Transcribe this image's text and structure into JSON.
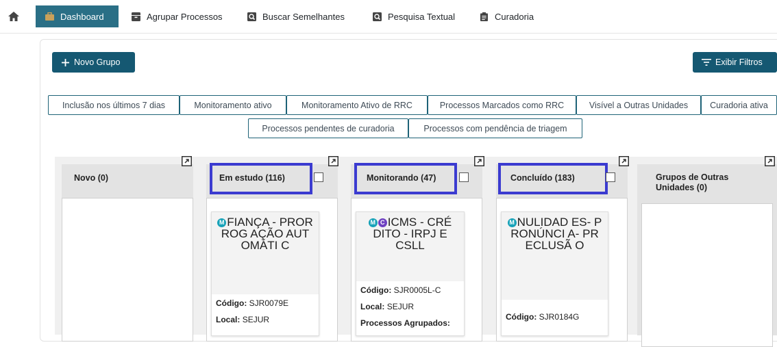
{
  "nav": {
    "items": [
      {
        "label": "Dashboard",
        "icon": "briefcase-icon"
      },
      {
        "label": "Agrupar Processos",
        "icon": "archive-icon"
      },
      {
        "label": "Buscar Semelhantes",
        "icon": "search-doc-icon"
      },
      {
        "label": "Pesquisa Textual",
        "icon": "search-doc-icon"
      },
      {
        "label": "Curadoria",
        "icon": "clipboard-icon"
      }
    ]
  },
  "toolbar": {
    "new_group": "Novo Grupo",
    "filters": "Exibir Filtros"
  },
  "chips": [
    "Inclusão nos últimos 7 dias",
    "Monitoramento ativo",
    "Monitoramento Ativo de RRC",
    "Processos Marcados como RRC",
    "Visível a Outras Unidades",
    "Curadoria ativa",
    "Processos pendentes de curadoria",
    "Processos com pendência de triagem"
  ],
  "columns": [
    {
      "title": "Novo (0)"
    },
    {
      "title": "Em estudo (116)"
    },
    {
      "title": "Monitorando (47)"
    },
    {
      "title": "Concluído (183)"
    },
    {
      "title": "Grupos de Outras Unidades (0)"
    }
  ],
  "cards": [
    {
      "badges": [
        "M"
      ],
      "title": "FIANÇA - PRORROG AÇÃO AUTOMÁTI C",
      "code_label": "Código:",
      "code": "SJR0079E",
      "local_label": "Local:",
      "local": "SEJUR"
    },
    {
      "badges": [
        "M",
        "C"
      ],
      "title": "ICMS - CRÉDITO - IRPJ E CSLL",
      "code_label": "Código:",
      "code": "SJR0005L-C",
      "local_label": "Local:",
      "local": "SEJUR",
      "extra": "Processos Agrupados:"
    },
    {
      "badges": [
        "M"
      ],
      "title": "NULIDAD ES- PRONÚNCI A- PRECLUSÃ O",
      "code_label": "Código:",
      "code": "SJR0184G"
    }
  ],
  "colors": {
    "primary": "#155872",
    "active_nav": "#2a6f86",
    "highlight": "#3b3bd0",
    "badge_m": "#17a2b8",
    "badge_c": "#6f42c1"
  }
}
